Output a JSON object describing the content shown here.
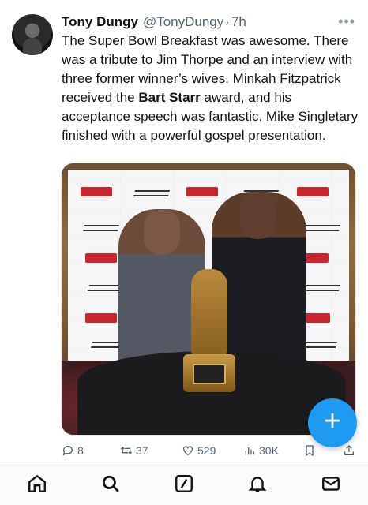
{
  "tweet": {
    "author_name": "Tony Dungy",
    "author_handle": "@TonyDungy",
    "separator": "·",
    "time": "7h",
    "more_icon": "ellipsis-icon",
    "text_part1": "The Super Bowl Breakfast was awesome. There was a tribute to Jim Thorpe and an interview with three former winner’s wives. Minkah Fitzpatrick received the ",
    "text_bold": "Bart Starr",
    "text_part2": " award, and his acceptance speech was fantastic. Mike Singletary finished with a powerful gospel presentation."
  },
  "actions": {
    "reply_count": "8",
    "retweet_count": "37",
    "like_count": "529",
    "views_count": "30K"
  },
  "compose_button": {
    "label": "+",
    "icon": "plus-icon",
    "color": "#1d9bf0"
  },
  "tabbar": [
    "home-icon",
    "search-icon",
    "compose-icon",
    "notifications-icon",
    "messages-icon"
  ],
  "colors": {
    "accent": "#1d9bf0",
    "text": "#0f1419",
    "muted": "#536471"
  }
}
